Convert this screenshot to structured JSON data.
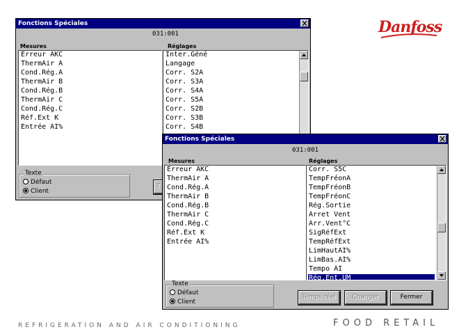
{
  "brand": {
    "logo_text": "Danfoss",
    "logo_color": "#cc1f1f"
  },
  "footer": {
    "left_text": "REFRIGERATION AND AIR CONDITIONING",
    "right_text": "FOOD RETAIL"
  },
  "colors": {
    "titlebar": "#000080",
    "dialog_face": "#c0c0c0",
    "selection": "#000080"
  },
  "window_back": {
    "title": "Fonctions Spéciales",
    "code": "031:001",
    "mesures_header": "Mesures",
    "reglages_header": "Réglages",
    "mesures": [
      "Erreur AKC",
      "ThermAir A",
      "Cond.Rég.A",
      "ThermAir B",
      "Cond.Rég.B",
      "ThermAir C",
      "Cond.Rég.C",
      "Réf.Ext K",
      "Entrée AI%"
    ],
    "reglages": [
      "Inter.Géné",
      "Langage",
      "Corr. S2A",
      "Corr. S3A",
      "Corr. S4A",
      "Corr. S5A",
      "Corr. S2B",
      "Corr. S3B",
      "Corr. S4B"
    ],
    "groupbox_label": "Texte",
    "radio_default": "Défaut",
    "radio_client": "Client"
  },
  "window_front": {
    "title": "Fonctions Spéciales",
    "code": "031:001",
    "mesures_header": "Mesures",
    "reglages_header": "Réglages",
    "mesures": [
      "Erreur AKC",
      "ThermAir A",
      "Cond.Rég.A",
      "ThermAir B",
      "Cond.Rég.B",
      "ThermAir C",
      "Cond.Rég.C",
      "Réf.Ext K",
      "Entrée AI%"
    ],
    "reglages": [
      "Corr. S5C",
      "TempFréonA",
      "TempFréonB",
      "TempFréonC",
      "Rég.Sortie",
      "Arret Vent",
      "Arr.Vent°C",
      "SigRéfExt",
      "TempRéfExt",
      "LimHautAI%",
      "LimBas.AI%",
      "Tempo AI",
      "Rég.Ent.UM"
    ],
    "selected_reglage": "Rég.Ent.UM",
    "groupbox_label": "Texte",
    "radio_default": "Défaut",
    "radio_client": "Client",
    "selected_radio": "Client",
    "btn_temps_reel": "Temps réel",
    "btn_changer": "Changer",
    "btn_fermer": "Fermer"
  }
}
